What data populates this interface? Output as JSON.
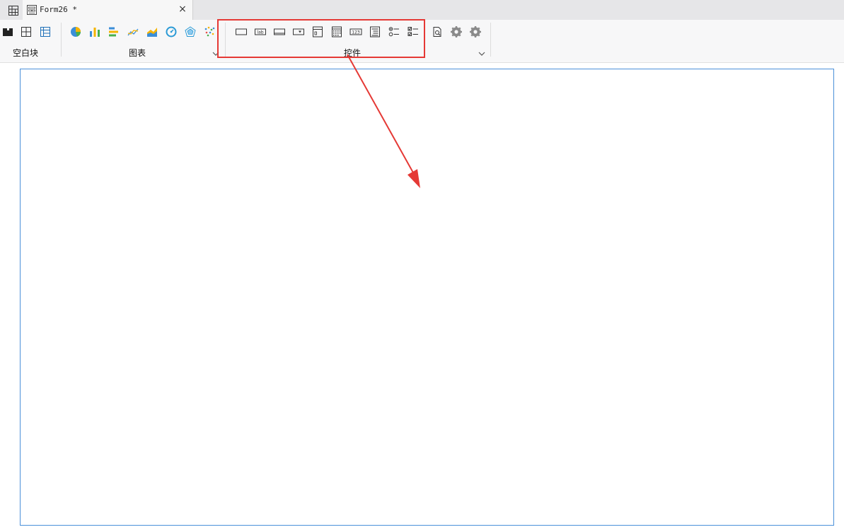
{
  "tab": {
    "title": "Form26 *",
    "close_glyph": "×"
  },
  "toolbar": {
    "groups": [
      {
        "label": "空白块"
      },
      {
        "label": "图表"
      },
      {
        "label": "控件"
      }
    ]
  },
  "colors": {
    "highlight": "#e53935",
    "canvas_border": "#4a90d9",
    "toolbar_bg": "#f7f7f8",
    "tabbar_bg": "#e6e6e8"
  },
  "icons": [
    "grid-icon",
    "form-doc-icon",
    "close-icon",
    "absolute-block-icon",
    "split-layout-icon",
    "table-layout-icon",
    "pie-chart-icon",
    "bar-chart-icon",
    "horizontal-bar-chart-icon",
    "line-chart-icon",
    "area-chart-icon",
    "gauge-chart-icon",
    "radar-chart-icon",
    "scatter-chart-icon",
    "textbox-icon",
    "label-icon",
    "button-icon",
    "dropdown-icon",
    "list-icon",
    "calendar-icon",
    "number-input-icon",
    "tree-icon",
    "radio-group-icon",
    "checkbox-group-icon",
    "preview-icon",
    "settings-gear-icon",
    "settings-gear-icon"
  ]
}
